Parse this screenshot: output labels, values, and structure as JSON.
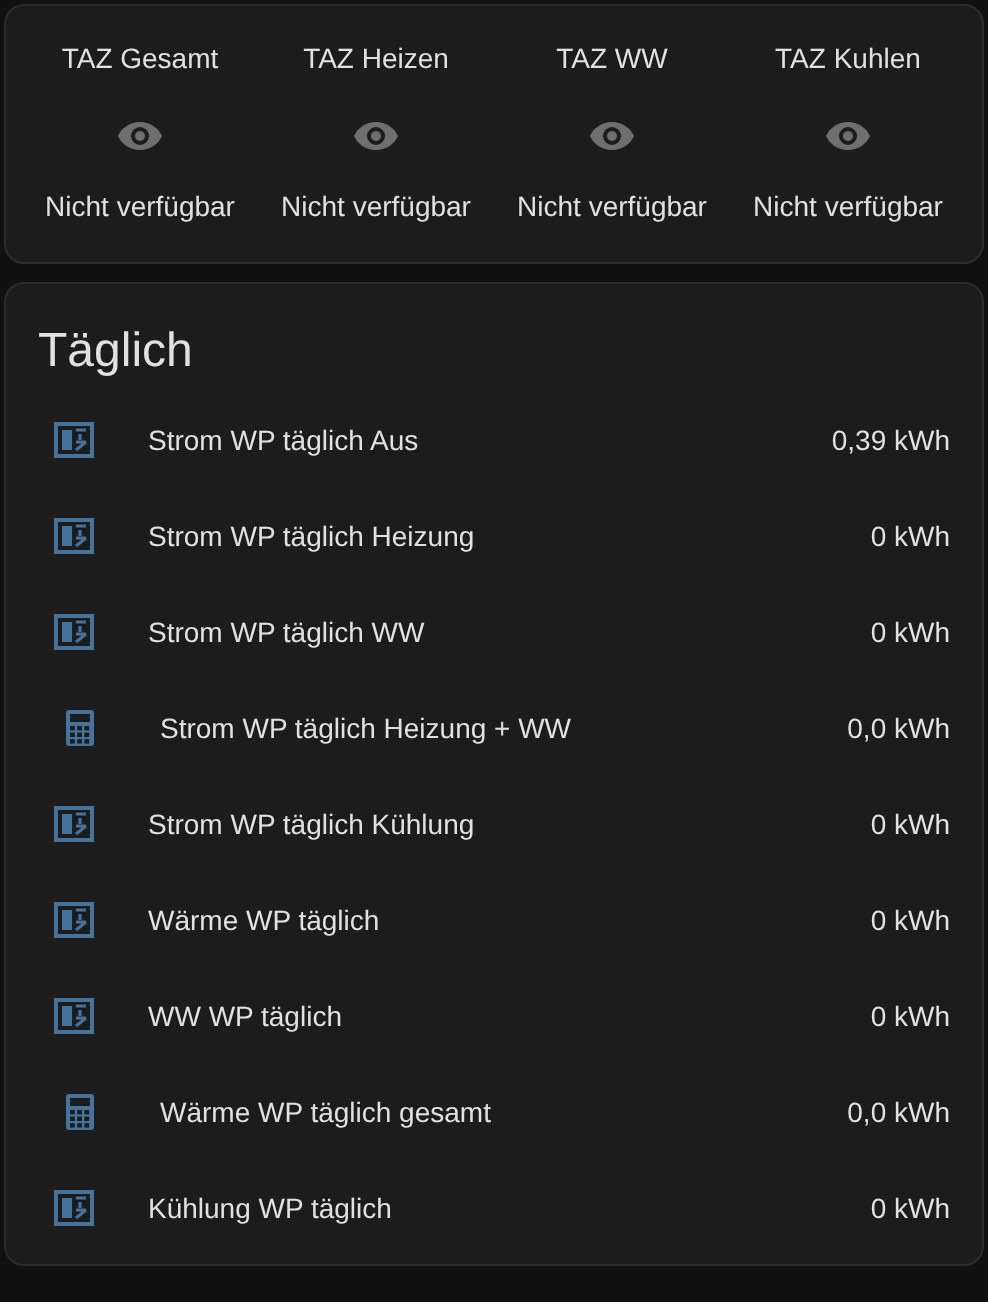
{
  "glance": [
    {
      "name": "TAZ Gesamt",
      "state": "Nicht verfügbar"
    },
    {
      "name": "TAZ Heizen",
      "state": "Nicht verfügbar"
    },
    {
      "name": "TAZ WW",
      "state": "Nicht verfügbar"
    },
    {
      "name": "TAZ Kuhlen",
      "state": "Nicht verfügbar"
    }
  ],
  "entities": {
    "title": "Täglich",
    "rows": [
      {
        "kind": "meter",
        "name": "Strom WP täglich Aus",
        "value": "0,39 kWh"
      },
      {
        "kind": "meter",
        "name": "Strom WP täglich Heizung",
        "value": "0 kWh"
      },
      {
        "kind": "meter",
        "name": "Strom WP täglich WW",
        "value": "0 kWh"
      },
      {
        "kind": "calculator",
        "name": "Strom WP täglich Heizung + WW",
        "value": "0,0 kWh"
      },
      {
        "kind": "meter",
        "name": "Strom WP täglich Kühlung",
        "value": "0 kWh"
      },
      {
        "kind": "meter",
        "name": "Wärme WP täglich",
        "value": "0 kWh"
      },
      {
        "kind": "meter",
        "name": "WW WP täglich",
        "value": "0 kWh"
      },
      {
        "kind": "calculator",
        "name": "Wärme WP täglich gesamt",
        "value": "0,0 kWh"
      },
      {
        "kind": "meter",
        "name": "Kühlung WP täglich",
        "value": "0 kWh"
      }
    ]
  }
}
